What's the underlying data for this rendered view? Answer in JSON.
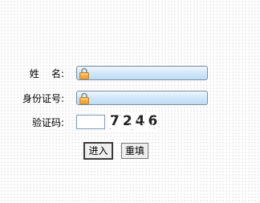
{
  "form": {
    "name_label": "姓    名:",
    "id_label": "身份证号:",
    "captcha_label": "验证码:",
    "name_value": "",
    "id_value": "",
    "captcha_value": "",
    "captcha_image_text": "7246",
    "enter_button": "进入",
    "reset_button": "重填"
  },
  "colors": {
    "field_gradient_top": "#eef6fd",
    "field_gradient_bottom": "#bfdcf4",
    "field_border": "#7a8ca3",
    "lock_body": "#f2a93b"
  },
  "icons": {
    "field_icon": "lock-icon"
  }
}
